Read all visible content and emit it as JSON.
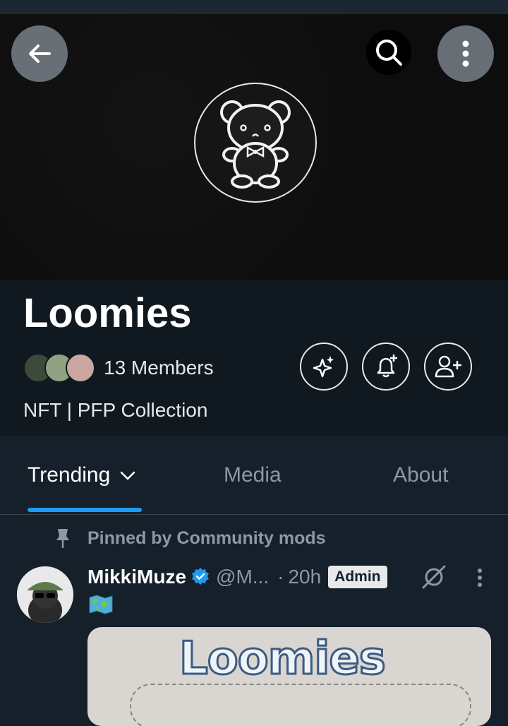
{
  "community": {
    "name": "Loomies",
    "members_label": "13 Members",
    "description": "NFT | PFP Collection"
  },
  "tabs": [
    {
      "label": "Trending",
      "active": true
    },
    {
      "label": "Media",
      "active": false
    },
    {
      "label": "About",
      "active": false
    }
  ],
  "pinned": {
    "label": "Pinned by Community mods"
  },
  "post": {
    "name": "MikkiMuze",
    "handle": "@M...",
    "separator": "·",
    "time": "20h",
    "badge": "Admin",
    "image_text": "Loomies"
  },
  "icons": {
    "back": "arrow-left-icon",
    "search": "search-icon",
    "more": "more-vertical-icon",
    "spark": "sparkle-icon",
    "bell": "bell-plus-icon",
    "join": "person-add-icon",
    "pin": "pin-icon",
    "verified": "verified-badge-icon",
    "post_more": "more-vertical-icon"
  },
  "colors": {
    "background": "#15202b",
    "accent": "#1d9bf0",
    "muted": "#8b98a5"
  }
}
